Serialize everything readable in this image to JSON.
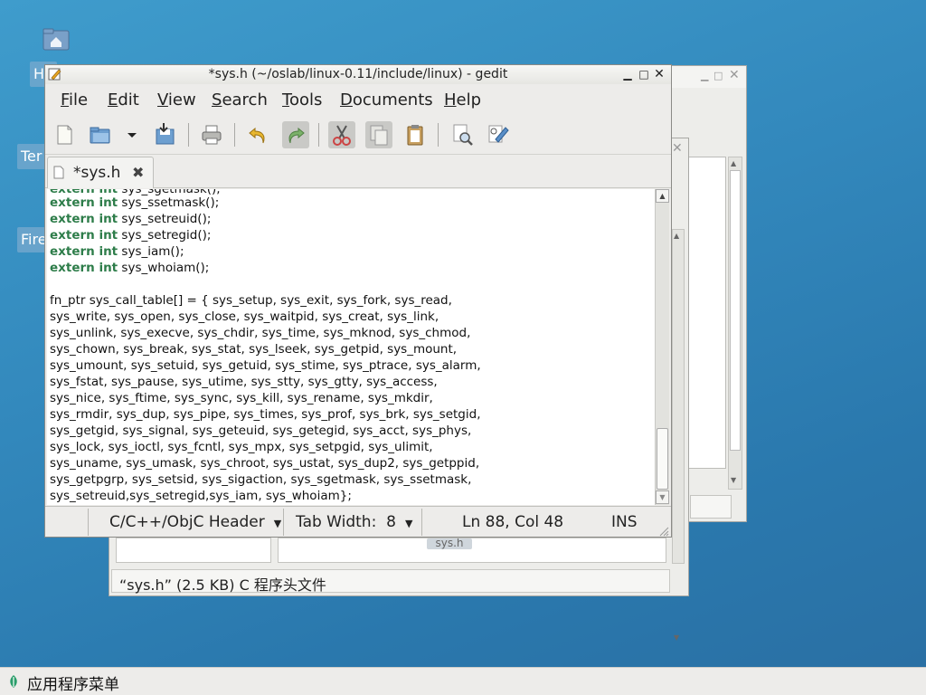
{
  "desktop": {
    "icons": [
      {
        "label": "Ho"
      },
      {
        "label": "Ter"
      },
      {
        "label": "Fire"
      }
    ]
  },
  "file_manager": {
    "status_text": "“sys.h” (2.5 KB) C 程序头文件",
    "partial_cells": [
      "sys.h"
    ]
  },
  "gedit": {
    "title": "*sys.h (~/oslab/linux-0.11/include/linux) - gedit",
    "menu": [
      "File",
      "Edit",
      "View",
      "Search",
      "Tools",
      "Documents",
      "Help"
    ],
    "menu_mnemonics": [
      "F",
      "E",
      "V",
      "S",
      "T",
      "D",
      "H"
    ],
    "toolbar": {
      "icons": [
        "new-document-icon",
        "open-icon",
        "dropdown-arrow-icon",
        "save-icon",
        "print-icon",
        "undo-icon",
        "redo-icon",
        "cut-icon",
        "copy-icon",
        "paste-icon",
        "find-icon",
        "replace-icon"
      ]
    },
    "tab": {
      "label": "*sys.h",
      "close_glyph": "✖"
    },
    "code": {
      "keyword_lines": [
        {
          "kw": "extern int",
          "rest": " sys_sgetmask();"
        },
        {
          "kw": "extern int",
          "rest": " sys_ssetmask();"
        },
        {
          "kw": "extern int",
          "rest": " sys_setreuid();"
        },
        {
          "kw": "extern int",
          "rest": " sys_setregid();"
        },
        {
          "kw": "extern int",
          "rest": " sys_iam();"
        },
        {
          "kw": "extern int",
          "rest": " sys_whoiam();"
        }
      ],
      "table_lines": [
        "fn_ptr sys_call_table[] = { sys_setup, sys_exit, sys_fork, sys_read,",
        "sys_write, sys_open, sys_close, sys_waitpid, sys_creat, sys_link,",
        "sys_unlink, sys_execve, sys_chdir, sys_time, sys_mknod, sys_chmod,",
        "sys_chown, sys_break, sys_stat, sys_lseek, sys_getpid, sys_mount,",
        "sys_umount, sys_setuid, sys_getuid, sys_stime, sys_ptrace, sys_alarm,",
        "sys_fstat, sys_pause, sys_utime, sys_stty, sys_gtty, sys_access,",
        "sys_nice, sys_ftime, sys_sync, sys_kill, sys_rename, sys_mkdir,",
        "sys_rmdir, sys_dup, sys_pipe, sys_times, sys_prof, sys_brk, sys_setgid,",
        "sys_getgid, sys_signal, sys_geteuid, sys_getegid, sys_acct, sys_phys,",
        "sys_lock, sys_ioctl, sys_fcntl, sys_mpx, sys_setpgid, sys_ulimit,",
        "sys_uname, sys_umask, sys_chroot, sys_ustat, sys_dup2, sys_getppid,",
        "sys_getpgrp, sys_setsid, sys_sigaction, sys_sgetmask, sys_ssetmask,",
        "sys_setreuid,sys_setregid,sys_iam, sys_whoiam};"
      ]
    },
    "statusbar": {
      "language": "C/C++/ObjC Header",
      "tab_width": "Tab Width:  8",
      "cursor": "Ln 88, Col 48",
      "mode": "INS"
    }
  },
  "taskbar": {
    "menu_label": "应用程序菜单"
  },
  "colors": {
    "keyword": "#2e7d4a",
    "desktop_bg": "#3389bd"
  }
}
